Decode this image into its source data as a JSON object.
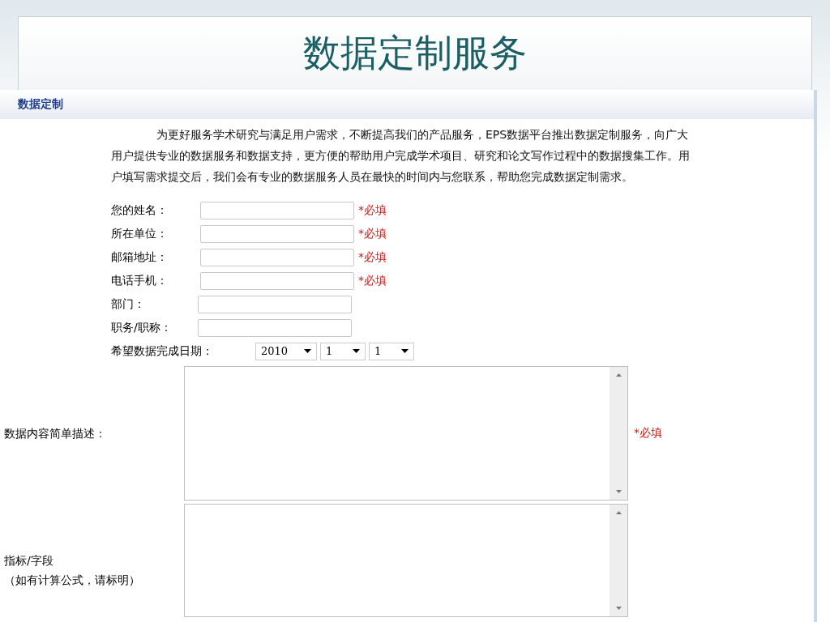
{
  "slide": {
    "title": "数据定制服务"
  },
  "section": {
    "heading": "数据定制"
  },
  "intro": "为更好服务学术研究与满足用户需求，不断提高我们的产品服务，EPS数据平台推出数据定制服务，向广大用户提供专业的数据服务和数据支持，更方便的帮助用户完成学术项目、研究和论文写作过程中的数据搜集工作。用户填写需求提交后，我们会有专业的数据服务人员在最快的时间内与您联系，帮助您完成数据定制需求。",
  "fields": [
    {
      "label": "您的姓名：",
      "required_mark": "*必填"
    },
    {
      "label": "所在单位：",
      "required_mark": "*必填"
    },
    {
      "label": "邮箱地址：",
      "required_mark": "*必填"
    },
    {
      "label": "电话手机：",
      "required_mark": "*必填"
    },
    {
      "label": "部门："
    },
    {
      "label": "职务/职称："
    }
  ],
  "date_field": {
    "label": "希望数据完成日期：",
    "selects": [
      "2010",
      "1",
      "1"
    ]
  },
  "text_areas": [
    {
      "label_lines": [
        "数据内容简单描述："
      ],
      "required_mark": "*必填"
    },
    {
      "label_lines": [
        "指标/字段",
        "（如有计算公式，请标明）"
      ]
    }
  ]
}
